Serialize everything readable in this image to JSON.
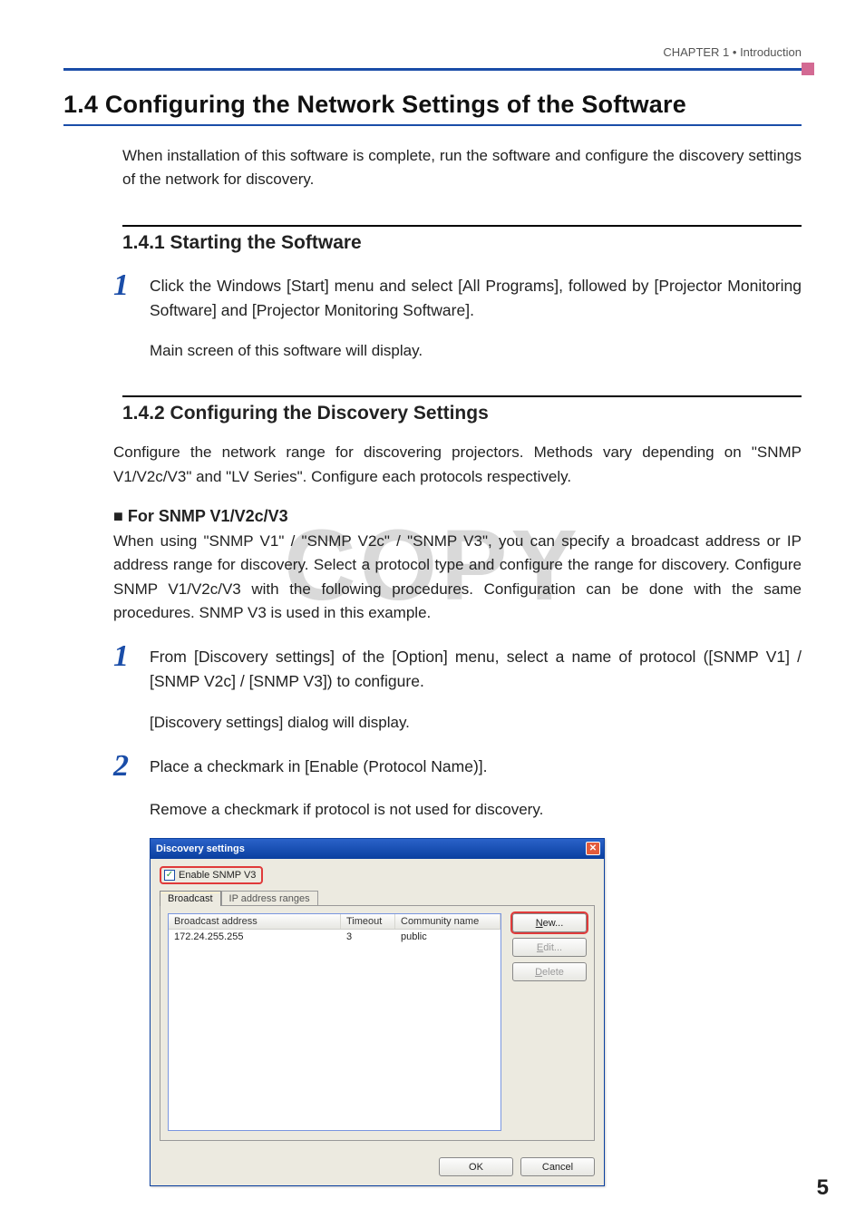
{
  "header": {
    "chapter": "CHAPTER 1 • Introduction"
  },
  "watermark": "COPY",
  "section": {
    "num_title": "1.4  Configuring the Network Settings of the Software",
    "intro": "When installation of this software is complete, run the software and configure the discovery settings of the network for discovery."
  },
  "sub1": {
    "heading": "1.4.1   Starting the Software",
    "step1_num": "1",
    "step1": "Click the Windows [Start] menu and select [All Programs], followed by [Projector Monitoring Software] and [Projector Monitoring Software].",
    "step1_sub": "Main screen of this software will display."
  },
  "sub2": {
    "heading": "1.4.2   Configuring the Discovery Settings",
    "para1": "Configure the network range for discovering projectors. Methods vary depending on \"SNMP V1/V2c/V3\" and \"LV Series\". Configure each protocols respectively.",
    "bullet_heading": "■  For SNMP V1/V2c/V3",
    "para2": "When using \"SNMP V1\" / \"SNMP V2c\" / \"SNMP V3\", you can specify a broadcast address or IP address range for discovery. Select a protocol type and configure the range for discovery. Configure SNMP V1/V2c/V3 with the following procedures. Configuration can be done with the same procedures. SNMP V3 is used in this example.",
    "step1_num": "1",
    "step1": "From [Discovery settings] of the [Option] menu, select a name of protocol ([SNMP V1] / [SNMP V2c] / [SNMP V3]) to configure.",
    "step1_sub": "[Discovery settings] dialog will display.",
    "step2_num": "2",
    "step2": "Place a checkmark in [Enable (Protocol Name)].",
    "step2_sub": "Remove a checkmark if protocol is not used for discovery."
  },
  "dialog": {
    "title": "Discovery settings",
    "close_glyph": "✕",
    "enable_label": "Enable SNMP V3",
    "tabs": {
      "broadcast": "Broadcast",
      "ip_ranges": "IP address ranges"
    },
    "columns": {
      "addr": "Broadcast address",
      "timeout": "Timeout",
      "community": "Community name"
    },
    "rows": [
      {
        "addr": "172.24.255.255",
        "timeout": "3",
        "community": "public"
      }
    ],
    "buttons": {
      "new_u": "N",
      "new_rest": "ew...",
      "edit_u": "E",
      "edit_rest": "dit...",
      "del_u": "D",
      "del_rest": "elete",
      "ok": "OK",
      "cancel": "Cancel"
    }
  },
  "page_number": "5"
}
